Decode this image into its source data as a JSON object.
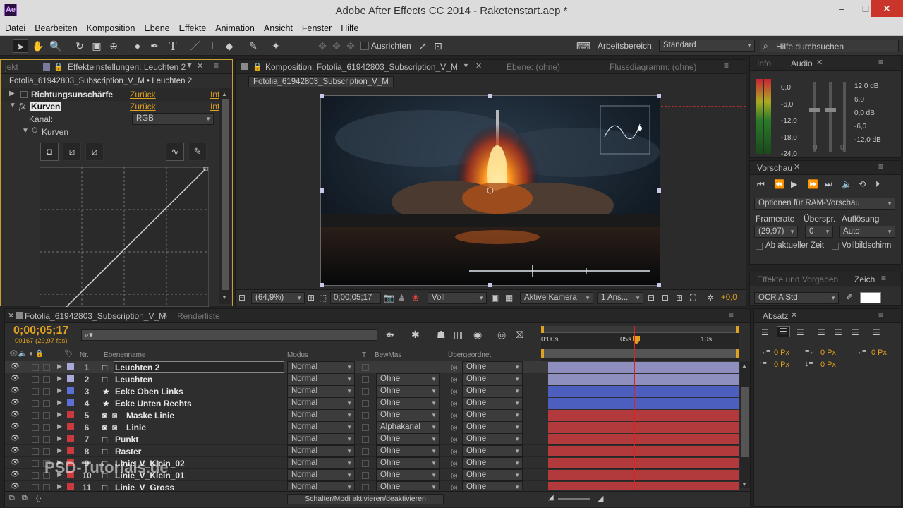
{
  "app": {
    "title": "Adobe After Effects CC 2014 - Raketenstart.aep *",
    "logo": "Ae"
  },
  "window_controls": {
    "minimize": "–",
    "maximize": "□",
    "close": "✕"
  },
  "menu": [
    "Datei",
    "Bearbeiten",
    "Komposition",
    "Ebene",
    "Effekte",
    "Animation",
    "Ansicht",
    "Fenster",
    "Hilfe"
  ],
  "toolbar": {
    "snap_label": "Ausrichten",
    "workspace_label": "Arbeitsbereich:",
    "workspace_value": "Standard",
    "help_placeholder": "Hilfe durchsuchen"
  },
  "effects_panel": {
    "tab_projekt": "jekt",
    "tab_label": "Effekteinstellungen: Leuchten 2",
    "breadcrumb": "Fotolia_61942803_Subscription_V_M • Leuchten 2",
    "effects": [
      {
        "name": "Richtungsunschärfe",
        "reset": "Zurück",
        "info": "Inf"
      },
      {
        "name": "Kurven",
        "reset": "Zurück",
        "info": "Inf"
      }
    ],
    "channel_label": "Kanal:",
    "channel_value": "RGB",
    "curves_label": "Kurven"
  },
  "comp_panel": {
    "tab_label": "Komposition: Fotolia_61942803_Subscription_V_M",
    "tab_layer": "Ebene: (ohne)",
    "tab_flow": "Flussdiagramm: (ohne)",
    "comp_name": "Fotolia_61942803_Subscription_V_M",
    "zoom": "(64,9%)",
    "timecode": "0;00;05;17",
    "resolution": "Voll",
    "camera": "Aktive Kamera",
    "views": "1 Ans...",
    "exposure": "+0,0"
  },
  "info_panel": {
    "tab_info": "Info",
    "tab_audio": "Audio",
    "left_scale": [
      "0,0",
      "-6,0",
      "-12,0",
      "-18,0",
      "-24,0"
    ],
    "right_scale": [
      "12,0 dB",
      "6,0",
      "0,0 dB",
      "-6,0",
      "-12,0 dB"
    ],
    "zero_left": "0",
    "zero_right": "0"
  },
  "preview_panel": {
    "tab": "Vorschau",
    "ram_options": "Optionen für RAM-Vorschau",
    "framerate_label": "Framerate",
    "framerate_value": "(29,97)",
    "skip_label": "Überspr.",
    "skip_value": "0",
    "resolution_label": "Auflösung",
    "resolution_value": "Auto",
    "from_current": "Ab aktueller Zeit",
    "fullscreen": "Vollbildschirm"
  },
  "effects_presets": {
    "tab": "Effekte und Vorgaben",
    "tab2": "Zeich"
  },
  "character": {
    "font": "OCR A Std"
  },
  "paragraph": {
    "tab": "Absatz",
    "indent_values": [
      "0 Px",
      "0 Px",
      "0 Px",
      "0 Px",
      "0 Px"
    ]
  },
  "timeline": {
    "tab_label": "Fotolia_61942803_Subscription_V_M",
    "tab_render": "Renderliste",
    "timecode": "0;00;05;17",
    "frame_info": "00167 (29,97 fps)",
    "search_placeholder": "",
    "columns": {
      "nr": "Nr.",
      "name": "Ebenenname",
      "mode": "Modus",
      "t": "T",
      "trkmat": "BewMas",
      "parent": "Übergeordnet"
    },
    "ruler": [
      "0:00s",
      "05s",
      "10s"
    ],
    "toggle_label": "Schalter/Modi aktivieren/deaktivieren",
    "layers": [
      {
        "nr": "1",
        "name": "Leuchten 2",
        "mode": "Normal",
        "trkmat": "",
        "parent": "Ohne",
        "color": "#a9a9d9",
        "icon": "solid",
        "bar": "#8f8fbf"
      },
      {
        "nr": "2",
        "name": "Leuchten",
        "mode": "Normal",
        "trkmat": "Ohne",
        "parent": "Ohne",
        "color": "#a9a9d9",
        "icon": "solid",
        "bar": "#8f8fbf"
      },
      {
        "nr": "3",
        "name": "Ecke Oben Links",
        "mode": "Normal",
        "trkmat": "Ohne",
        "parent": "Ohne",
        "color": "#5b6fd6",
        "icon": "star",
        "bar": "#4c5fbf"
      },
      {
        "nr": "4",
        "name": "Ecke Unten Rechts",
        "mode": "Normal",
        "trkmat": "Ohne",
        "parent": "Ohne",
        "color": "#5b6fd6",
        "icon": "star",
        "bar": "#4c5fbf"
      },
      {
        "nr": "5",
        "name": "Maske Linie",
        "mode": "Normal",
        "trkmat": "Ohne",
        "parent": "Ohne",
        "color": "#c9393d",
        "icon": "precomp",
        "bar": "#b33a3c"
      },
      {
        "nr": "6",
        "name": "Linie",
        "mode": "Normal",
        "trkmat": "Alphakanal",
        "parent": "Ohne",
        "color": "#c9393d",
        "icon": "precomp",
        "bar": "#b33a3c"
      },
      {
        "nr": "7",
        "name": "Punkt",
        "mode": "Normal",
        "trkmat": "Ohne",
        "parent": "Ohne",
        "color": "#c9393d",
        "icon": "solid",
        "bar": "#b33a3c"
      },
      {
        "nr": "8",
        "name": "Raster",
        "mode": "Normal",
        "trkmat": "Ohne",
        "parent": "Ohne",
        "color": "#c9393d",
        "icon": "solid",
        "bar": "#b33a3c"
      },
      {
        "nr": "9",
        "name": "Linie_V_Klein_02",
        "mode": "Normal",
        "trkmat": "Ohne",
        "parent": "Ohne",
        "color": "#c9393d",
        "icon": "solid",
        "bar": "#b33a3c"
      },
      {
        "nr": "10",
        "name": "Linie_V_Klein_01",
        "mode": "Normal",
        "trkmat": "Ohne",
        "parent": "Ohne",
        "color": "#c9393d",
        "icon": "solid",
        "bar": "#b33a3c"
      },
      {
        "nr": "11",
        "name": "Linie_V_Gross",
        "mode": "Normal",
        "trkmat": "Ohne",
        "parent": "Ohne",
        "color": "#c9393d",
        "icon": "solid",
        "bar": "#b33a3c"
      }
    ]
  },
  "watermark": "PSD-Tutorials.de"
}
